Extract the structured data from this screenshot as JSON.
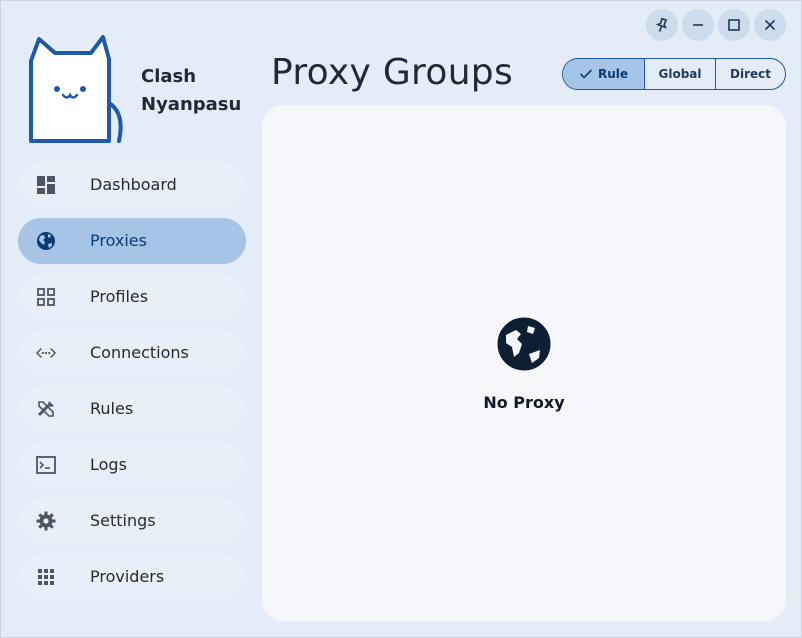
{
  "app": {
    "name_line1": "Clash",
    "name_line2": "Nyanpasu"
  },
  "sidebar": {
    "items": [
      {
        "label": "Dashboard",
        "icon": "dashboard-icon"
      },
      {
        "label": "Proxies",
        "icon": "globe-icon",
        "active": true
      },
      {
        "label": "Profiles",
        "icon": "grid-icon"
      },
      {
        "label": "Connections",
        "icon": "code-arrows-icon"
      },
      {
        "label": "Rules",
        "icon": "tools-icon"
      },
      {
        "label": "Logs",
        "icon": "terminal-icon"
      },
      {
        "label": "Settings",
        "icon": "gear-icon"
      },
      {
        "label": "Providers",
        "icon": "apps-icon"
      }
    ]
  },
  "header": {
    "title": "Proxy Groups"
  },
  "window_controls": [
    "pin-icon",
    "minimize-icon",
    "maximize-icon",
    "close-icon"
  ],
  "mode": {
    "options": [
      "Rule",
      "Global",
      "Direct"
    ],
    "selected": "Rule"
  },
  "content": {
    "empty_text": "No Proxy"
  },
  "colors": {
    "accent": "#a5c4e6",
    "accent_border": "#1e5aa8",
    "background": "#e4edf7",
    "panel": "#f5f7fb"
  }
}
